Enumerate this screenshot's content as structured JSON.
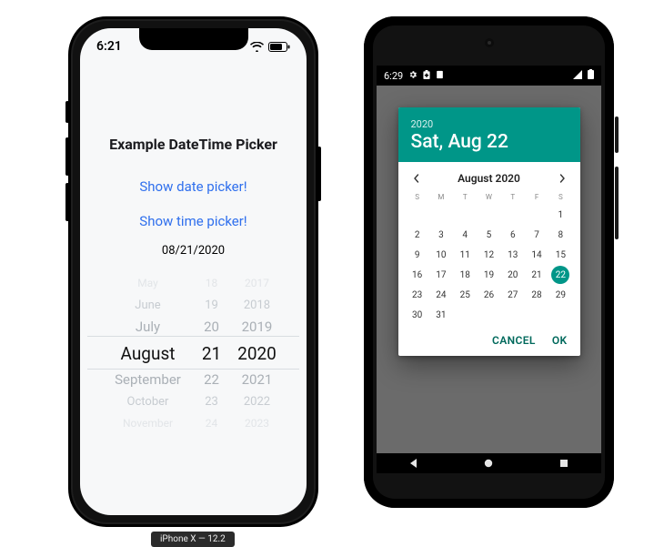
{
  "iphone": {
    "status": {
      "time": "6:21"
    },
    "title": "Example DateTime Picker",
    "link_date": "Show date picker!",
    "link_time": "Show time picker!",
    "date_value": "08/21/2020",
    "wheel": {
      "months": [
        "May",
        "June",
        "July",
        "August",
        "September",
        "October",
        "November"
      ],
      "days": [
        "18",
        "19",
        "20",
        "21",
        "22",
        "23",
        "24"
      ],
      "years": [
        "2017",
        "2018",
        "2019",
        "2020",
        "2021",
        "2022",
        "2023"
      ]
    },
    "caption": "iPhone X — 12.2"
  },
  "android": {
    "status": {
      "time": "6:29"
    },
    "dialog": {
      "year": "2020",
      "headline": "Sat, Aug 22",
      "month_label": "August 2020",
      "weekdays": [
        "S",
        "M",
        "T",
        "W",
        "T",
        "F",
        "S"
      ],
      "first_weekday_index": 6,
      "days_in_month": 31,
      "selected_day": 22,
      "cancel": "CANCEL",
      "ok": "OK"
    }
  }
}
